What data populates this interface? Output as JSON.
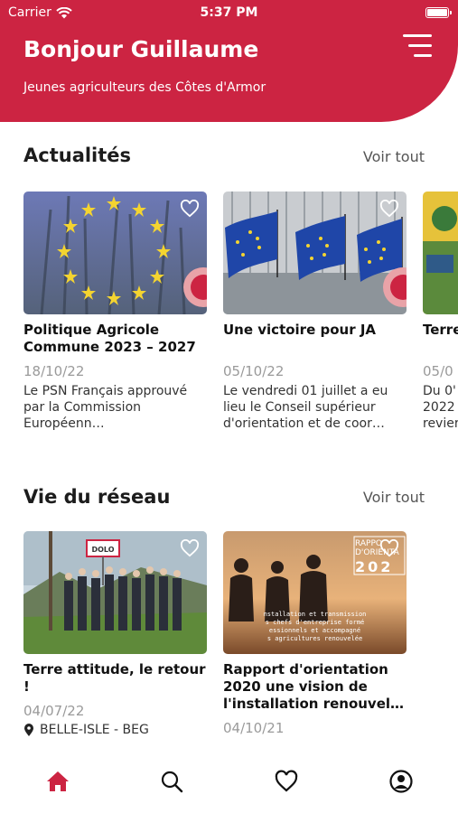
{
  "status_bar": {
    "carrier": "Carrier",
    "time": "5:37 PM"
  },
  "header": {
    "greeting": "Bonjour Guillaume",
    "subtitle": "Jeunes agriculteurs des Côtes d'Armor"
  },
  "news": {
    "title": "Actualités",
    "see_all": "Voir tout",
    "items": [
      {
        "title": "Politique Agricole Commune 2023 – 2027",
        "date": "18/10/22",
        "excerpt": "Le PSN Français approuvé par la Commission Européenn…"
      },
      {
        "title": "Une victoire pour JA",
        "date": "05/10/22",
        "excerpt": "Le vendredi 01 juillet a eu lieu le Conseil supérieur d'orientation et de coor…"
      },
      {
        "title": "Terre",
        "date": "05/0",
        "excerpt": "Du 0' 2022 revier"
      }
    ]
  },
  "network": {
    "title": "Vie du réseau",
    "see_all": "Voir tout",
    "items": [
      {
        "title": "Terre attitude, le retour !",
        "date": "04/07/22",
        "location": "BELLE-ISLE - BEG",
        "sign_text": "DOLO"
      },
      {
        "title": "Rapport d'orientation 2020 une vision de l'installation renouvel…",
        "date": "04/10/21",
        "overlay_title": "RAPPO D'ORIENTA",
        "overlay_year": "202",
        "overlay_lines": [
          "nstallation et transmission",
          "s chefs d'entreprise formé",
          "essionnels et accompagné",
          "s agricultures renouvelée"
        ]
      }
    ]
  },
  "tabs": [
    "home-icon",
    "search-icon",
    "heart-icon",
    "profile-icon"
  ],
  "colors": {
    "brand": "#cc2442",
    "active_tab": "#cc2442",
    "inactive_tab": "#111111"
  }
}
